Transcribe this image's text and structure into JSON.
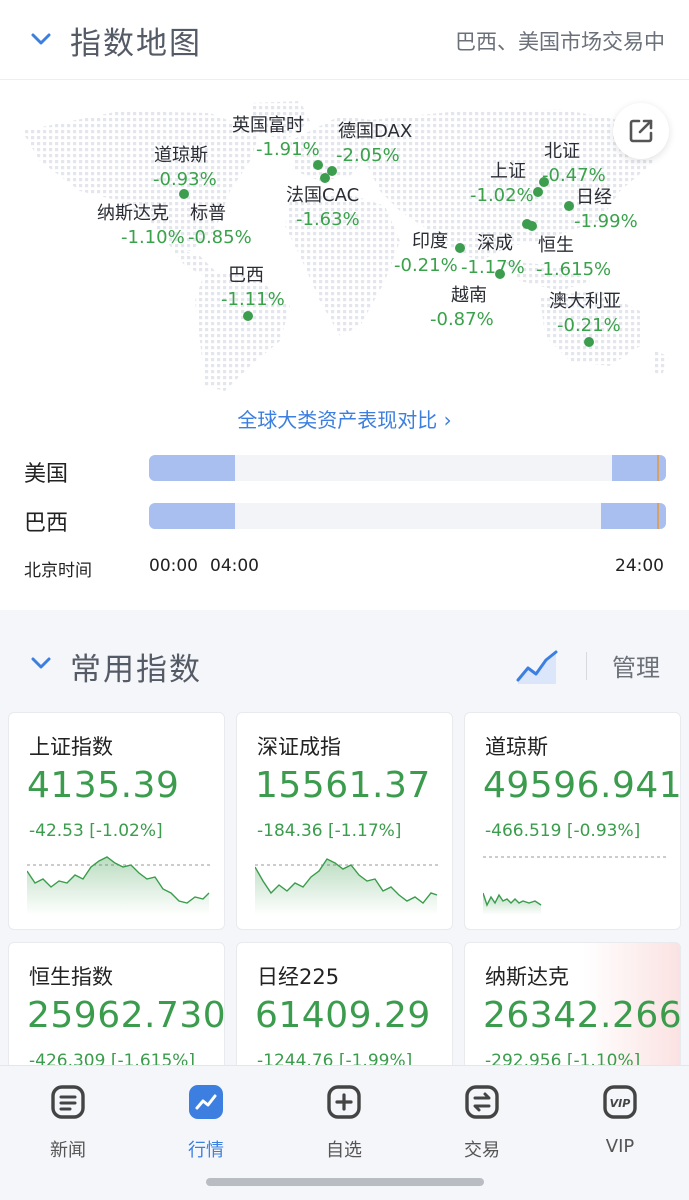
{
  "header": {
    "title": "指数地图",
    "market_status": "巴西、美国市场交易中"
  },
  "map": {
    "markers": [
      {
        "name": "英国富时",
        "change": "-1.91%"
      },
      {
        "name": "德国DAX",
        "change": "-2.05%"
      },
      {
        "name": "道琼斯",
        "change": "-0.93%"
      },
      {
        "name": "法国CAC",
        "change": "-1.63%"
      },
      {
        "name": "纳斯达克",
        "change": "-1.10%"
      },
      {
        "name": "标普",
        "change": "-0.85%"
      },
      {
        "name": "巴西",
        "change": "-1.11%"
      },
      {
        "name": "上证",
        "change": "-1.02%"
      },
      {
        "name": "北证",
        "change": "-0.47%"
      },
      {
        "name": "日经",
        "change": "-1.99%"
      },
      {
        "name": "印度",
        "change": "-0.21%"
      },
      {
        "name": "深成",
        "change": "-1.17%"
      },
      {
        "name": "恒生",
        "change": "-1.615%"
      },
      {
        "name": "越南",
        "change": "-0.87%"
      },
      {
        "name": "澳大利亚",
        "change": "-0.21%"
      }
    ],
    "compare_link": "全球大类资产表现对比 ›"
  },
  "timeline": {
    "rows": [
      {
        "label": "美国"
      },
      {
        "label": "巴西"
      }
    ],
    "time_label": "北京时间",
    "ticks": [
      "00:00",
      "04:00",
      "24:00"
    ]
  },
  "indices": {
    "title": "常用指数",
    "manage": "管理",
    "cards": [
      {
        "name": "上证指数",
        "price": "4135.39",
        "change": "-42.53 [-1.02%]"
      },
      {
        "name": "深证成指",
        "price": "15561.37",
        "change": "-184.36 [-1.17%]"
      },
      {
        "name": "道琼斯",
        "price": "49596.941",
        "change": "-466.519 [-0.93%]"
      },
      {
        "name": "恒生指数",
        "price": "25962.730",
        "change": "-426.309 [-1.615%]"
      },
      {
        "name": "日经225",
        "price": "61409.29",
        "change": "-1244.76 [-1.99%]"
      },
      {
        "name": "纳斯达克",
        "price": "26342.266",
        "change": "-292.956 [-1.10%]"
      }
    ]
  },
  "nav": {
    "items": [
      {
        "label": "新闻",
        "icon": "news-icon"
      },
      {
        "label": "行情",
        "icon": "market-icon"
      },
      {
        "label": "自选",
        "icon": "watchlist-icon"
      },
      {
        "label": "交易",
        "icon": "trade-icon"
      },
      {
        "label": "VIP",
        "icon": "vip-icon"
      }
    ],
    "active": "行情"
  },
  "colors": {
    "down_green": "#3a9c4c",
    "accent_blue": "#3c7fe0",
    "session_bar": "#a9bff0"
  }
}
